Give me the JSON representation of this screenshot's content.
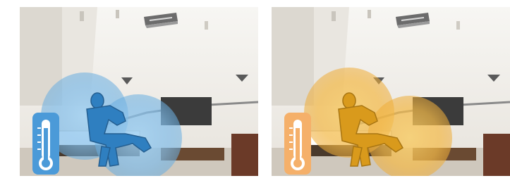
{
  "panels": [
    {
      "mode": "cooling",
      "accent_color": "#3a8fd0",
      "icons": [
        "thermometer-icon",
        "seated-person-icon",
        "ceiling-air-conditioner-icon"
      ]
    },
    {
      "mode": "heating",
      "accent_color": "#e8a030",
      "icons": [
        "thermometer-icon",
        "seated-person-icon",
        "ceiling-air-conditioner-icon"
      ]
    }
  ],
  "colors": {
    "cool_glow": "#8cc4ee",
    "warm_glow": "#f5c25a",
    "thermometer_cool_bg": "#4b9ad8",
    "thermometer_warm_bg": "#f5b06a",
    "room_wall": "#f4f2ee",
    "room_shadow": "#d8d4cc"
  }
}
